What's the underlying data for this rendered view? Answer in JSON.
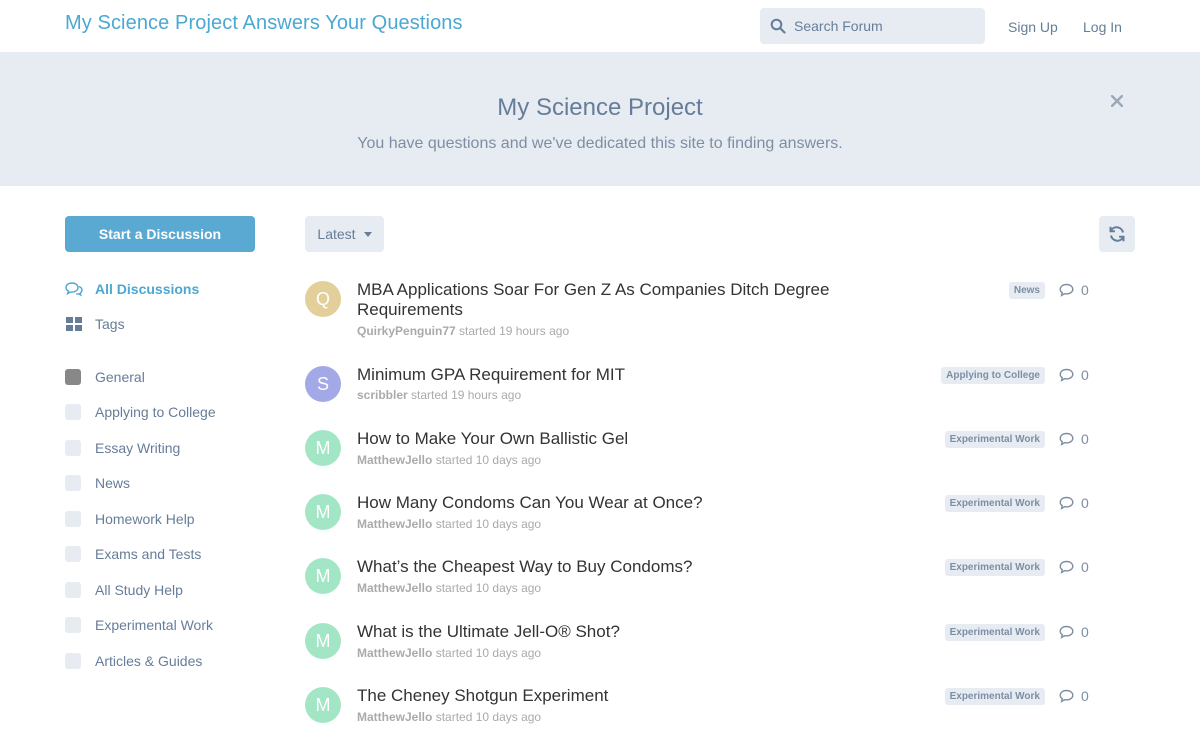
{
  "header": {
    "site_title": "My Science Project Answers Your Questions",
    "search_placeholder": "Search Forum",
    "sign_up": "Sign Up",
    "log_in": "Log In"
  },
  "hero": {
    "title": "My Science Project",
    "subtitle": "You have questions and we've dedicated this site to finding answers."
  },
  "sidebar": {
    "start_button": "Start a Discussion",
    "nav": [
      {
        "label": "All Discussions",
        "icon": "comments-icon"
      },
      {
        "label": "Tags",
        "icon": "tags-grid-icon"
      }
    ],
    "tags": [
      {
        "label": "General"
      },
      {
        "label": "Applying to College"
      },
      {
        "label": "Essay Writing"
      },
      {
        "label": "News"
      },
      {
        "label": "Homework Help"
      },
      {
        "label": "Exams and Tests"
      },
      {
        "label": "All Study Help"
      },
      {
        "label": "Experimental Work"
      },
      {
        "label": "Articles & Guides"
      }
    ]
  },
  "toolbar": {
    "sort_label": "Latest"
  },
  "discussions": [
    {
      "avatar_letter": "Q",
      "avatar_color": "#e3cf9a",
      "title": "MBA Applications Soar For Gen Z As Companies Ditch Degree Requirements",
      "author": "QuirkyPenguin77",
      "time": "started 19 hours ago",
      "tag": "News",
      "replies": "0"
    },
    {
      "avatar_letter": "S",
      "avatar_color": "#a3a8e6",
      "title": "Minimum GPA Requirement for MIT",
      "author": "scribbler",
      "time": "started 19 hours ago",
      "tag": "Applying to College",
      "replies": "0"
    },
    {
      "avatar_letter": "M",
      "avatar_color": "#a3e6c5",
      "title": "How to Make Your Own Ballistic Gel",
      "author": "MatthewJello",
      "time": "started 10 days ago",
      "tag": "Experimental Work",
      "replies": "0"
    },
    {
      "avatar_letter": "M",
      "avatar_color": "#a3e6c5",
      "title": "How Many Condoms Can You Wear at Once?",
      "author": "MatthewJello",
      "time": "started 10 days ago",
      "tag": "Experimental Work",
      "replies": "0"
    },
    {
      "avatar_letter": "M",
      "avatar_color": "#a3e6c5",
      "title": "What’s the Cheapest Way to Buy Condoms?",
      "author": "MatthewJello",
      "time": "started 10 days ago",
      "tag": "Experimental Work",
      "replies": "0"
    },
    {
      "avatar_letter": "M",
      "avatar_color": "#a3e6c5",
      "title": "What is the Ultimate Jell-O® Shot?",
      "author": "MatthewJello",
      "time": "started 10 days ago",
      "tag": "Experimental Work",
      "replies": "0"
    },
    {
      "avatar_letter": "M",
      "avatar_color": "#a3e6c5",
      "title": "The Cheney Shotgun Experiment",
      "author": "MatthewJello",
      "time": "started 10 days ago",
      "tag": "Experimental Work",
      "replies": "0"
    }
  ]
}
